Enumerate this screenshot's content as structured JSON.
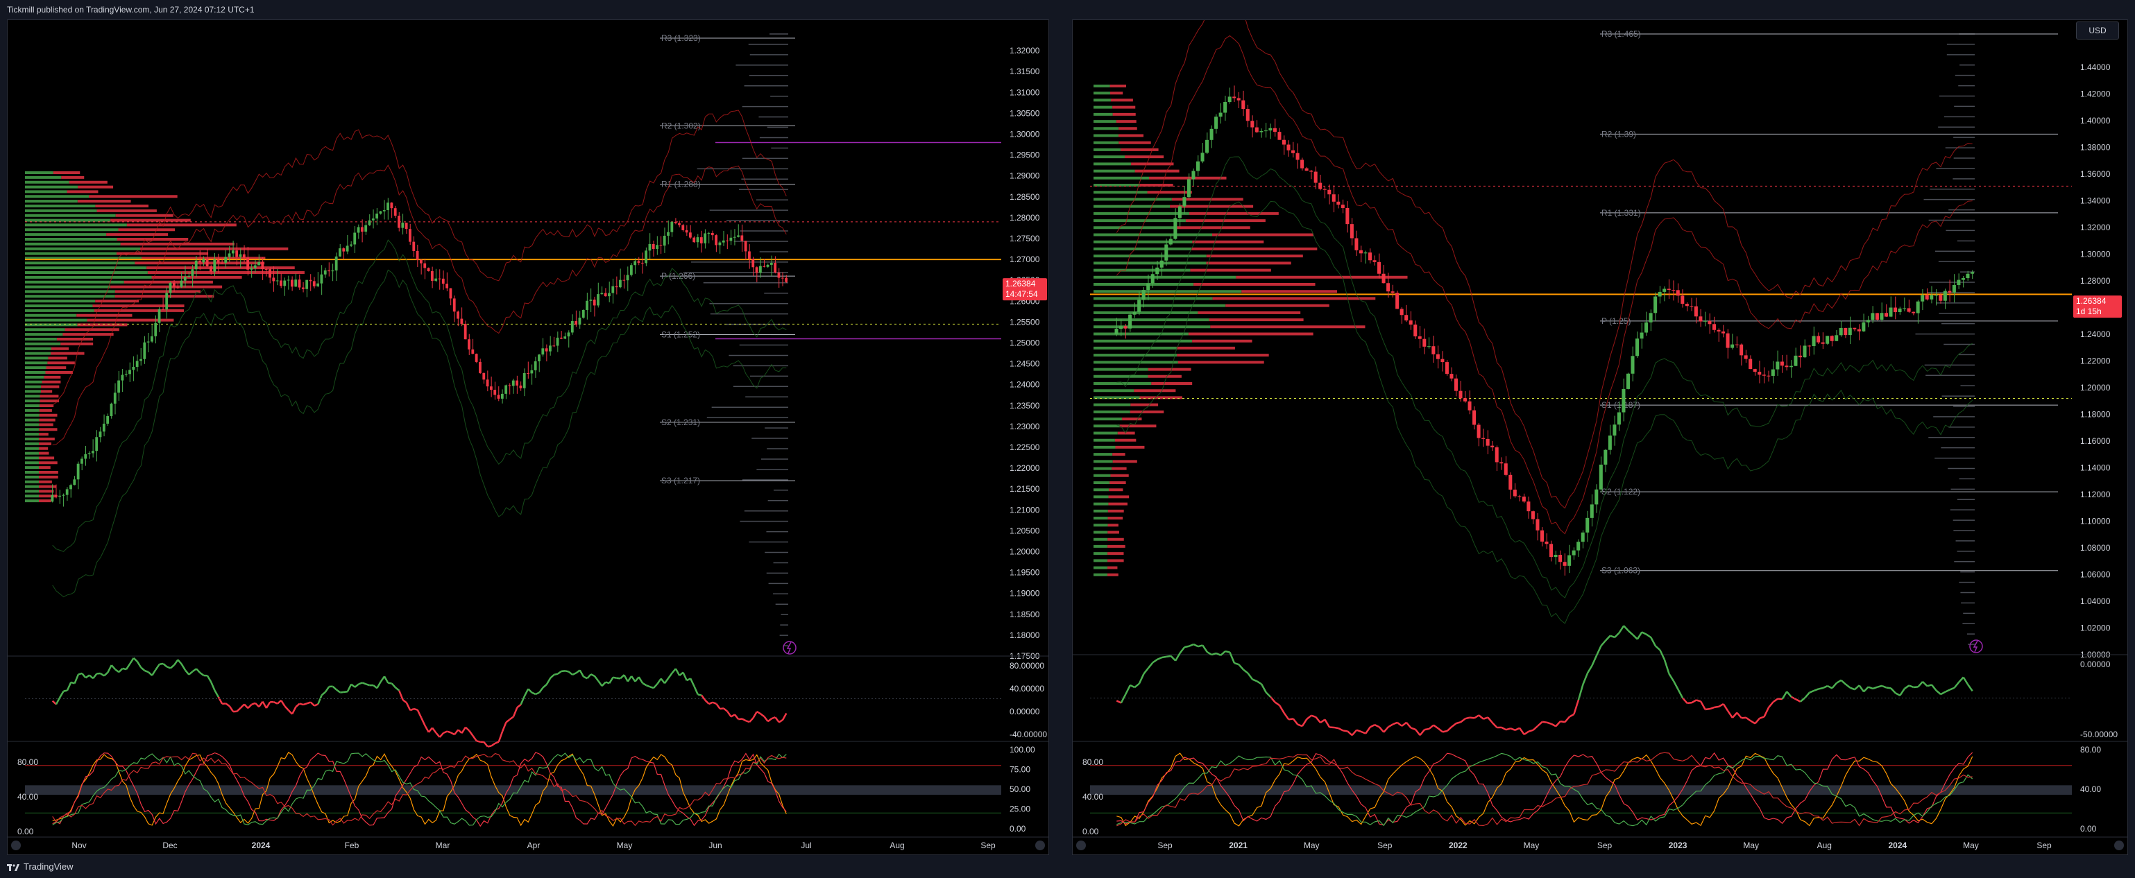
{
  "header": {
    "publisher_line": "Tickmill published on TradingView.com, Jun 27, 2024 07:12 UTC+1"
  },
  "footer": {
    "brand": "TradingView"
  },
  "colors": {
    "background": "#000000",
    "frame": "#131722",
    "grid": "#1e222d",
    "bull": "#4caf50",
    "bear": "#f23645",
    "accent_orange": "#ff9800",
    "purple": "#9c27b0",
    "blue": "#2962ff",
    "text": "#d1d4dc",
    "muted": "#787b86"
  },
  "icons": [
    "lightning-icon",
    "tradingview-logo-icon",
    "z-scale-icon",
    "auto-scale-icon"
  ],
  "charts": [
    {
      "id": "left",
      "price_axis": [
        "1.32000",
        "1.31500",
        "1.31000",
        "1.30500",
        "1.30000",
        "1.29500",
        "1.29000",
        "1.28500",
        "1.28000",
        "1.27500",
        "1.27000",
        "1.26500",
        "1.26000",
        "1.25500",
        "1.25000",
        "1.24500",
        "1.24000",
        "1.23500",
        "1.23000",
        "1.22500",
        "1.22000",
        "1.21500",
        "1.21000",
        "1.20500",
        "1.20000",
        "1.19500",
        "1.19000",
        "1.18500",
        "1.18000",
        "1.17500"
      ],
      "last_price": "1.26384",
      "countdown": "14:47:54",
      "pivots": [
        {
          "label": "R3 (1.323)",
          "price": 1.323
        },
        {
          "label": "R2 (1.302)",
          "price": 1.302
        },
        {
          "label": "R1 (1.288)",
          "price": 1.288
        },
        {
          "label": "P (1.266)",
          "price": 1.266
        },
        {
          "label": "S1 (1.252)",
          "price": 1.252
        },
        {
          "label": "S2 (1.231)",
          "price": 1.231
        },
        {
          "label": "S3 (1.217)",
          "price": 1.217
        }
      ],
      "time_axis": [
        "Nov",
        "Dec",
        "2024",
        "Feb",
        "Mar",
        "Apr",
        "May",
        "Jun",
        "Jul",
        "Aug",
        "Sep"
      ],
      "osc1_axis": [
        "80.00000",
        "40.00000",
        "0.00000",
        "-40.00000"
      ],
      "osc2_axis": [
        "100.00",
        "75.00",
        "50.00",
        "25.00",
        "0.00"
      ],
      "osc2_left_axis": [
        "80.00",
        "40.00",
        "0.00"
      ]
    },
    {
      "id": "right",
      "currency": "USD",
      "price_axis": [
        "1.44000",
        "1.42000",
        "1.40000",
        "1.38000",
        "1.36000",
        "1.34000",
        "1.32000",
        "1.30000",
        "1.28000",
        "1.26000",
        "1.24000",
        "1.22000",
        "1.20000",
        "1.18000",
        "1.16000",
        "1.14000",
        "1.12000",
        "1.10000",
        "1.08000",
        "1.06000",
        "1.04000",
        "1.02000",
        "1.00000"
      ],
      "last_price": "1.26384",
      "countdown": "1d 15h",
      "pivots": [
        {
          "label": "R3 (1.465)",
          "price": 1.465
        },
        {
          "label": "R2 (1.39)",
          "price": 1.39
        },
        {
          "label": "R1 (1.331)",
          "price": 1.331
        },
        {
          "label": "P (1.25)",
          "price": 1.25
        },
        {
          "label": "S1 (1.187)",
          "price": 1.187
        },
        {
          "label": "S2 (1.122)",
          "price": 1.122
        },
        {
          "label": "S3 (1.063)",
          "price": 1.063
        }
      ],
      "time_axis": [
        "Sep",
        "2021",
        "May",
        "Sep",
        "2022",
        "May",
        "Sep",
        "2023",
        "May",
        "Aug",
        "2024",
        "May",
        "Sep"
      ],
      "osc1_axis": [
        "0.00000",
        "-50.00000"
      ],
      "osc2_axis": [
        "80.00",
        "40.00",
        "0.00"
      ],
      "osc2_left_axis": [
        "80.00",
        "40.00",
        "0.00"
      ]
    }
  ]
}
